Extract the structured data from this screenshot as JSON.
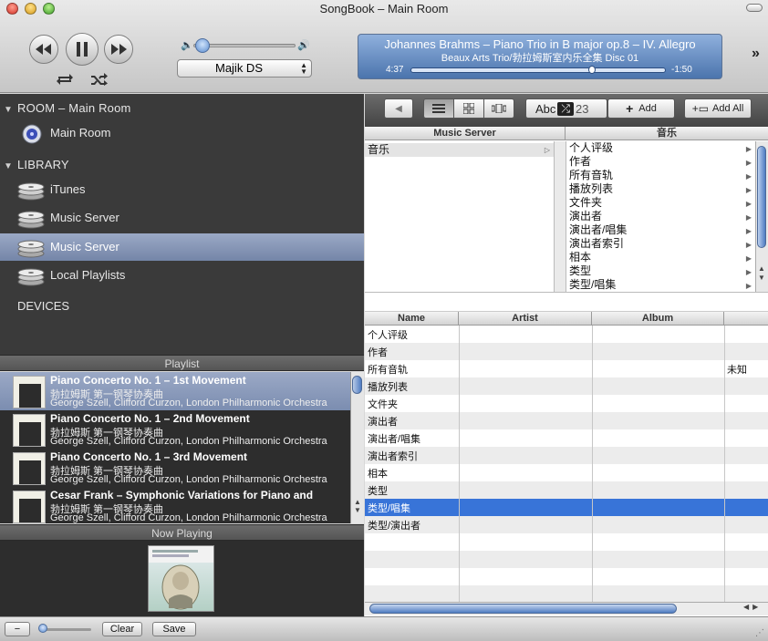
{
  "window": {
    "title": "SongBook – Main Room"
  },
  "transport": {
    "device": "Majik DS"
  },
  "now_playing": {
    "title": "Johannes Brahms – Piano Trio in B major op.8 – IV. Allegro",
    "subtitle": "Beaux Arts Trio/勃拉姆斯室内乐全集 Disc 01",
    "elapsed": "4:37",
    "remaining": "-1:50",
    "progress": 0.71
  },
  "sidebar": {
    "room_heading": "ROOM – Main Room",
    "rooms": [
      {
        "label": "Main Room"
      }
    ],
    "library_heading": "LIBRARY",
    "library": [
      {
        "label": "iTunes"
      },
      {
        "label": "Music Server"
      },
      {
        "label": "Music Server",
        "selected": true
      },
      {
        "label": "Local Playlists"
      }
    ],
    "devices_heading": "DEVICES"
  },
  "playlist": {
    "heading": "Playlist",
    "items": [
      {
        "title": "Piano Concerto No. 1 – 1st Movement",
        "subtitle": "勃拉姆斯 第一钢琴协奏曲",
        "artist": "George Szell, Clifford Curzon, London Philharmonic Orchestra",
        "selected": true
      },
      {
        "title": "Piano Concerto No. 1 – 2nd Movement",
        "subtitle": "勃拉姆斯 第一钢琴协奏曲",
        "artist": "George Szell, Clifford Curzon, London Philharmonic Orchestra"
      },
      {
        "title": "Piano Concerto No. 1 – 3rd Movement",
        "subtitle": "勃拉姆斯 第一钢琴协奏曲",
        "artist": "George Szell, Clifford Curzon, London Philharmonic Orchestra"
      },
      {
        "title": "Cesar Frank – Symphonic Variations for Piano and",
        "subtitle": "勃拉姆斯 第一钢琴协奏曲",
        "artist": "George Szell, Clifford Curzon, London Philharmonic Orchestra"
      }
    ]
  },
  "now_playing_heading": "Now Playing",
  "browser": {
    "toolbar": {
      "sort_label": "Abc",
      "sort_num": "23",
      "add_label": "Add",
      "add_all_label": "Add All"
    },
    "server_header": "Music Server",
    "category_header": "音乐",
    "servers": [
      "音乐"
    ],
    "categories": [
      "个人评级",
      "作者",
      "所有音轨",
      "播放列表",
      "文件夹",
      "演出者",
      "演出者/唱集",
      "演出者索引",
      "相本",
      "类型",
      "类型/唱集"
    ]
  },
  "tracks": {
    "columns": {
      "name": "Name",
      "artist": "Artist",
      "album": "Album",
      "extra": ""
    },
    "rows": [
      {
        "name": "个人评级",
        "artist": "",
        "album": "",
        "extra": ""
      },
      {
        "name": "作者",
        "artist": "",
        "album": "",
        "extra": ""
      },
      {
        "name": "所有音轨",
        "artist": "",
        "album": "",
        "extra": "未知"
      },
      {
        "name": "播放列表",
        "artist": "",
        "album": "",
        "extra": ""
      },
      {
        "name": "文件夹",
        "artist": "",
        "album": "",
        "extra": ""
      },
      {
        "name": "演出者",
        "artist": "",
        "album": "",
        "extra": ""
      },
      {
        "name": "演出者/唱集",
        "artist": "",
        "album": "",
        "extra": ""
      },
      {
        "name": "演出者索引",
        "artist": "",
        "album": "",
        "extra": ""
      },
      {
        "name": "相本",
        "artist": "",
        "album": "",
        "extra": ""
      },
      {
        "name": "类型",
        "artist": "",
        "album": "",
        "extra": ""
      },
      {
        "name": "类型/唱集",
        "artist": "",
        "album": "",
        "extra": "",
        "selected": true
      },
      {
        "name": "类型/演出者",
        "artist": "",
        "album": "",
        "extra": ""
      }
    ]
  },
  "bottom": {
    "minus_label": "−",
    "clear_label": "Clear",
    "save_label": "Save"
  },
  "colors": {
    "selection": "#3874d8",
    "sidebar_bg": "#3a3a3a",
    "lcd": "#4b74ad"
  }
}
